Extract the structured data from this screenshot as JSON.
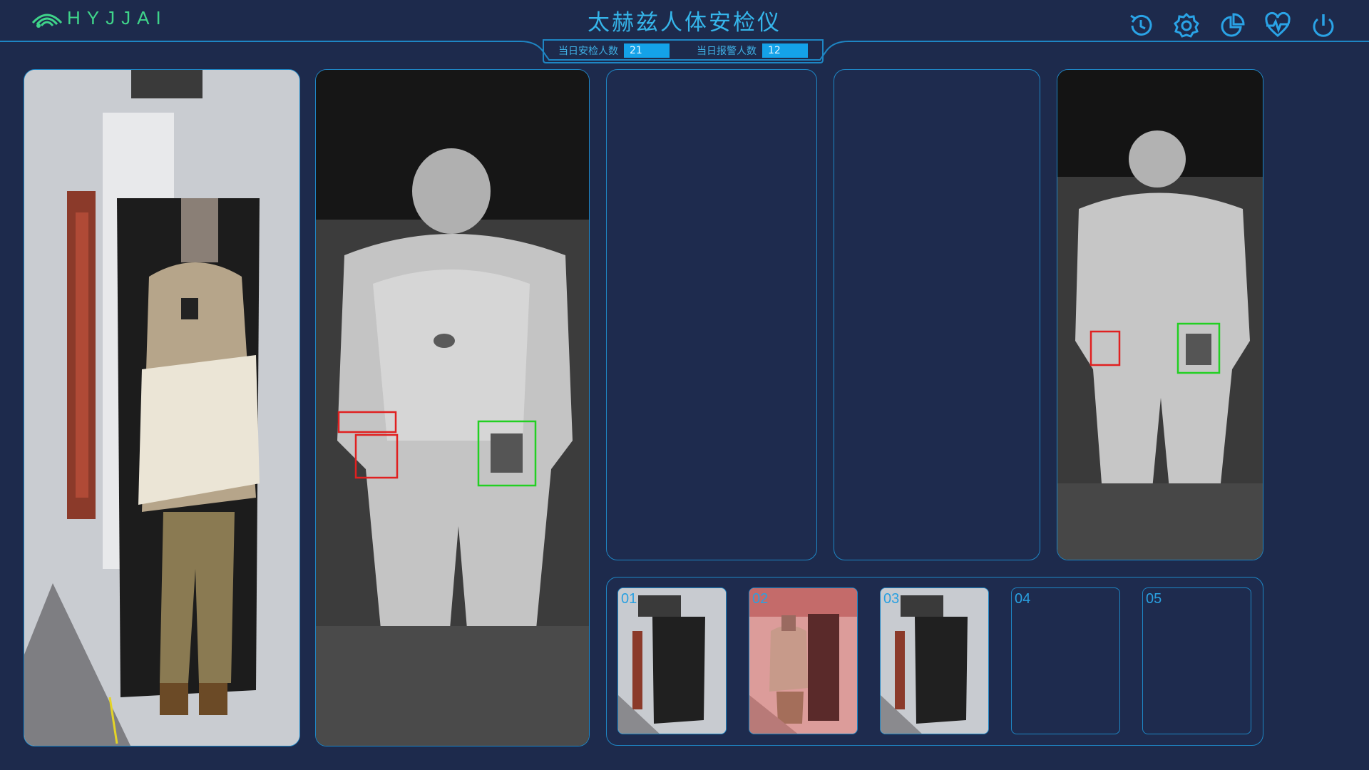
{
  "header": {
    "logo_text": "HYJJAI",
    "title": "太赫兹人体安检仪",
    "stats": [
      {
        "label": "当日安检人数",
        "value": "21"
      },
      {
        "label": "当日报警人数",
        "value": "12"
      }
    ],
    "toolbar": [
      "history-icon",
      "settings-icon",
      "pie-chart-icon",
      "monitor-icon",
      "power-icon"
    ]
  },
  "thumbnails": [
    {
      "label": "01",
      "state": "normal"
    },
    {
      "label": "02",
      "state": "alarm"
    },
    {
      "label": "03",
      "state": "normal"
    },
    {
      "label": "04",
      "state": "empty"
    },
    {
      "label": "05",
      "state": "empty"
    }
  ],
  "colors": {
    "background": "#1d2a4c",
    "accent": "#1ea0e6",
    "logo": "#3fd48a",
    "alarm_box": "#e02020",
    "clear_box": "#22d022"
  }
}
